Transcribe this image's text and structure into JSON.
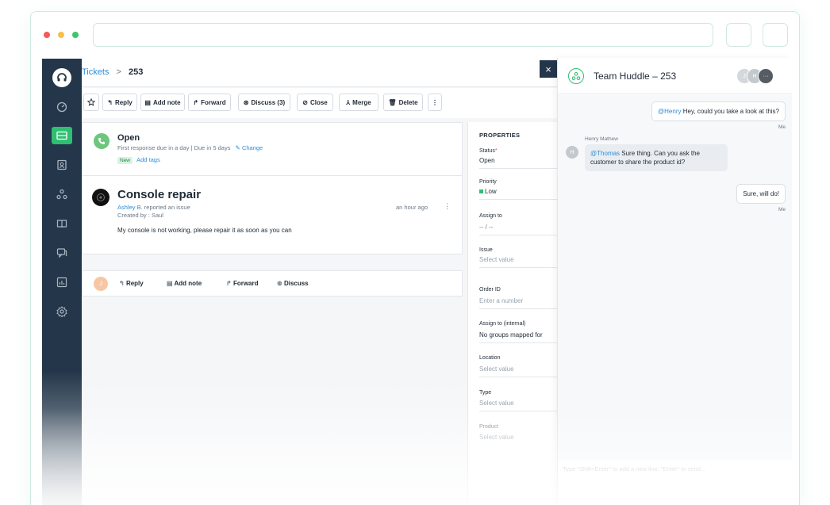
{
  "browser": {
    "dot_colors": [
      "#f45a5a",
      "#f7c04a",
      "#3ec46d"
    ]
  },
  "sidebar": {
    "items": [
      {
        "icon": "headset-icon"
      },
      {
        "icon": "dashboard-icon"
      },
      {
        "icon": "tickets-icon"
      },
      {
        "icon": "contacts-icon"
      },
      {
        "icon": "groups-icon"
      },
      {
        "icon": "book-icon"
      },
      {
        "icon": "chat-icon"
      },
      {
        "icon": "reports-icon"
      },
      {
        "icon": "settings-icon"
      }
    ]
  },
  "breadcrumb": {
    "tickets": "Tickets",
    "separator": ">",
    "ticket_number": "253"
  },
  "toolbar": {
    "reply": "Reply",
    "add_note": "Add note",
    "forward": "Forward",
    "discuss": "Discuss (3)",
    "close": "Close",
    "merge": "Merge",
    "delete": "Delete",
    "more": "⋮"
  },
  "status_card": {
    "status": "Open",
    "sla": "First response due in a day | Due in 5 days",
    "change": "Change",
    "new_badge": "New",
    "add_tags": "Add tags"
  },
  "ticket": {
    "title": "Console repair",
    "reporter": "Ashley B.",
    "reported_text": "reported an issue",
    "created_by": "Created by : Saul",
    "time": "an hour ago",
    "body": "My console is not working, please repair it as soon as you can"
  },
  "reply_bar": {
    "avatar": "J",
    "reply": "Reply",
    "add_note": "Add note",
    "forward": "Forward",
    "discuss": "Discuss"
  },
  "properties": {
    "heading": "PROPERTIES",
    "status_label": "Status",
    "required": "*",
    "status_value": "Open",
    "priority_label": "Priority",
    "priority_value": "Low",
    "priority_color": "#2fbf71",
    "assign_label": "Assign to",
    "assign_value": "-- / --",
    "issue_label": "Issue",
    "issue_value": "Select value",
    "order_label": "Order ID",
    "order_value": "Enter a number",
    "assign_internal_label": "Assign to (internal)",
    "assign_internal_value": "No groups mapped for",
    "location_label": "Location",
    "location_value": "Select value",
    "type_label": "Type",
    "type_value": "Select value",
    "product_label": "Product",
    "product_value": "Select value"
  },
  "close_panel": "×",
  "huddle": {
    "title": "Team Huddle",
    "dash": "–",
    "ticket": "253",
    "avatars": [
      "J",
      "H"
    ],
    "more": "···",
    "messages": [
      {
        "mention": "@Henry",
        "text": "Hey, could you take a look at this?",
        "meta": "Me"
      },
      {
        "sender": "Henry Mathew",
        "avatar": "H",
        "mention": "@Thomas",
        "text": "Sure thing. Can you ask the customer to share the product id?"
      },
      {
        "text": "Sure, will do!",
        "meta": "Me"
      }
    ],
    "input_placeholder": "Type \"Shift+Enter\" to add a new line. \"Enter\" to send..."
  },
  "colors": {
    "accent_green": "#2fbf71",
    "link_blue": "#2c8ed6",
    "sidebar_bg": "#24374a"
  }
}
